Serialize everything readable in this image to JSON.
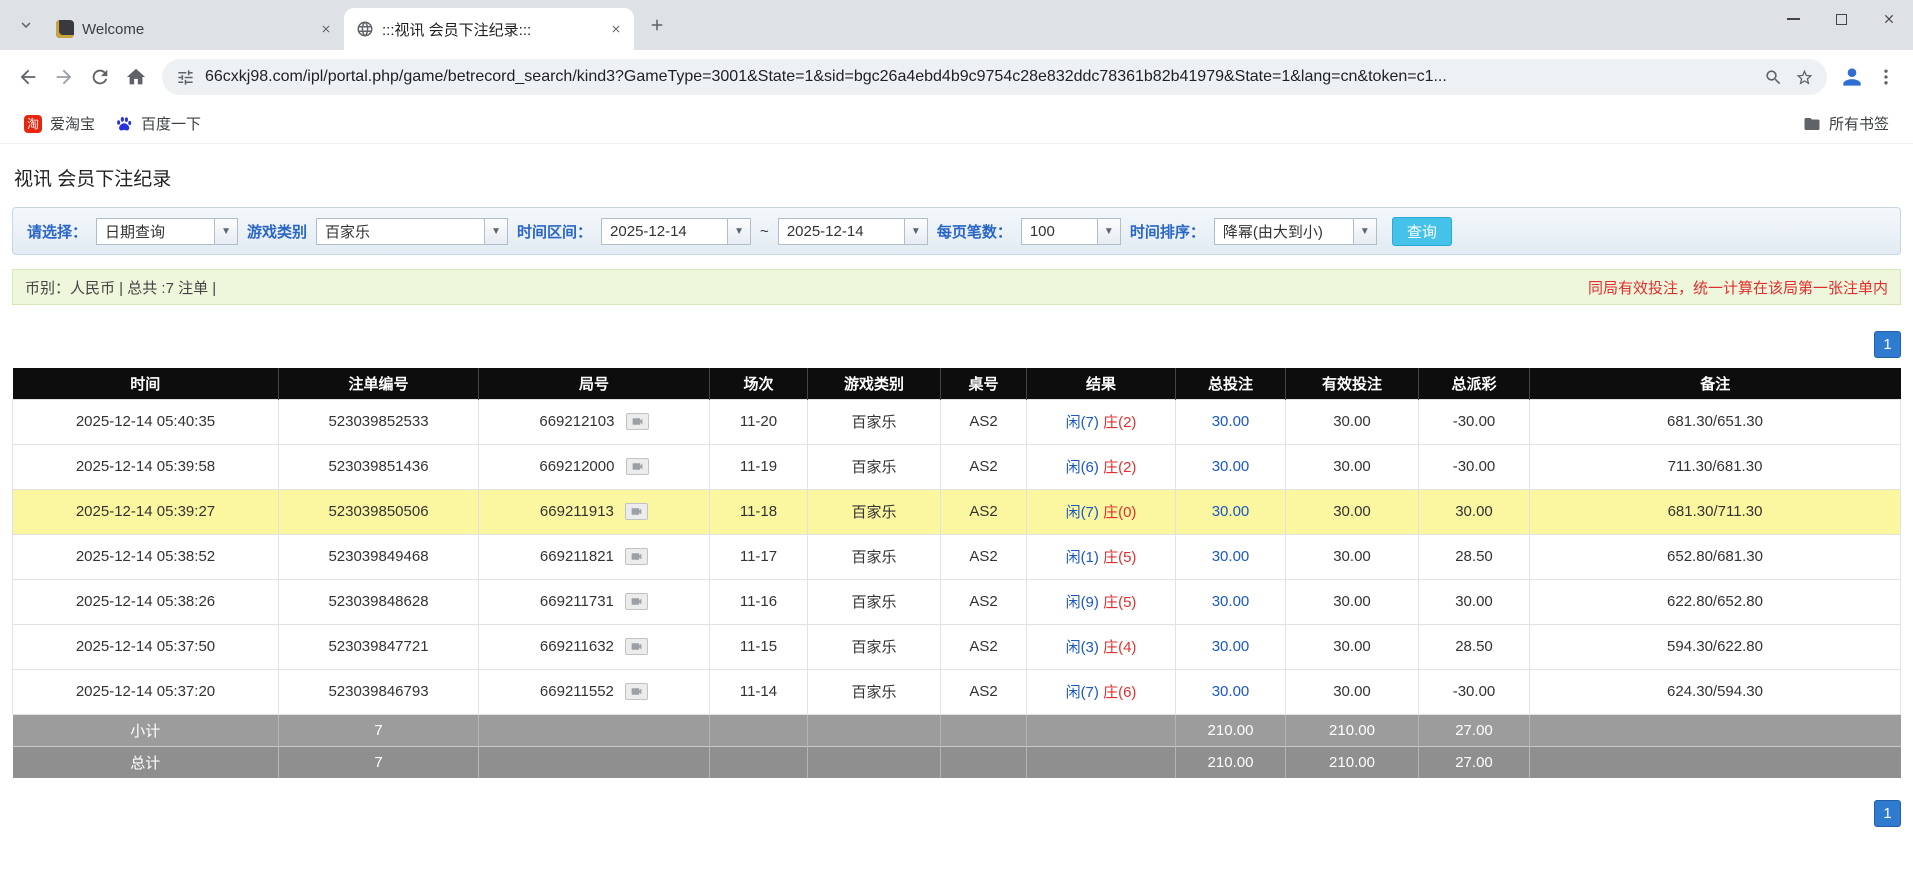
{
  "colors": {
    "accent_blue": "#2e7bd0",
    "link_blue": "#1a58c2",
    "loss_red": "#e02f2f",
    "notice_red": "#e12e2e",
    "highlight_yellow": "#fbf7a0",
    "header_black": "#0d0d0d",
    "footer_gray": "#9c9c9c",
    "footer_gray_dark": "#8f8f8f",
    "search_button_blue": "#45c2ea",
    "info_bar_green": "#eef6dc",
    "label_blue": "#2a66c8",
    "result_player_blue": "#1a58c2",
    "result_banker_red": "#e02f2f"
  },
  "browser": {
    "tabs": [
      {
        "title": "Welcome"
      },
      {
        "title": ":::视讯 会员下注纪录:::"
      }
    ],
    "url": "66cxkj98.com/ipl/portal.php/game/betrecord_search/kind3?GameType=3001&State=1&sid=bgc26a4ebd4b9c9754c28e832ddc78361b82b41979&State=1&lang=cn&token=c1...",
    "bookmarks": [
      {
        "label": "爱淘宝"
      },
      {
        "label": "百度一下"
      }
    ],
    "all_bookmarks_label": "所有书签"
  },
  "page": {
    "title": "视讯 会员下注纪录",
    "filters": {
      "select_label": "请选择：",
      "select_value": "日期查询",
      "game_type_label": "游戏类别",
      "game_type_value": "百家乐",
      "date_range_label": "时间区间：",
      "date_from": "2025-12-14",
      "tilde": "~",
      "date_to": "2025-12-14",
      "page_size_label": "每页笔数：",
      "page_size_value": "100",
      "sort_label": "时间排序：",
      "sort_value": "降幂(由大到小)",
      "search_button": "查询"
    },
    "info_bar": {
      "left": "币别：人民币 | 总共 :7 注单 |",
      "right": "同局有效投注，统一计算在该局第一张注单内"
    },
    "pagination": "1",
    "table": {
      "headers": [
        "时间",
        "注单编号",
        "局号",
        "场次",
        "游戏类别",
        "桌号",
        "结果",
        "总投注",
        "有效投注",
        "总派彩",
        "备注"
      ],
      "rows": [
        {
          "time": "2025-12-14 05:40:35",
          "bet_id": "523039852533",
          "round_id": "669212103",
          "session": "11-20",
          "game": "百家乐",
          "table_no": "AS2",
          "result_player": "闲(7)",
          "result_banker": "庄(2)",
          "total_bet": "30.00",
          "valid_bet": "30.00",
          "payout": "-30.00",
          "note": "681.30/651.30",
          "highlight": false
        },
        {
          "time": "2025-12-14 05:39:58",
          "bet_id": "523039851436",
          "round_id": "669212000",
          "session": "11-19",
          "game": "百家乐",
          "table_no": "AS2",
          "result_player": "闲(6)",
          "result_banker": "庄(2)",
          "total_bet": "30.00",
          "valid_bet": "30.00",
          "payout": "-30.00",
          "note": "711.30/681.30",
          "highlight": false
        },
        {
          "time": "2025-12-14 05:39:27",
          "bet_id": "523039850506",
          "round_id": "669211913",
          "session": "11-18",
          "game": "百家乐",
          "table_no": "AS2",
          "result_player": "闲(7)",
          "result_banker": "庄(0)",
          "total_bet": "30.00",
          "valid_bet": "30.00",
          "payout": "30.00",
          "note": "681.30/711.30",
          "highlight": true
        },
        {
          "time": "2025-12-14 05:38:52",
          "bet_id": "523039849468",
          "round_id": "669211821",
          "session": "11-17",
          "game": "百家乐",
          "table_no": "AS2",
          "result_player": "闲(1)",
          "result_banker": "庄(5)",
          "total_bet": "30.00",
          "valid_bet": "30.00",
          "payout": "28.50",
          "note": "652.80/681.30",
          "highlight": false
        },
        {
          "time": "2025-12-14 05:38:26",
          "bet_id": "523039848628",
          "round_id": "669211731",
          "session": "11-16",
          "game": "百家乐",
          "table_no": "AS2",
          "result_player": "闲(9)",
          "result_banker": "庄(5)",
          "total_bet": "30.00",
          "valid_bet": "30.00",
          "payout": "30.00",
          "note": "622.80/652.80",
          "highlight": false
        },
        {
          "time": "2025-12-14 05:37:50",
          "bet_id": "523039847721",
          "round_id": "669211632",
          "session": "11-15",
          "game": "百家乐",
          "table_no": "AS2",
          "result_player": "闲(3)",
          "result_banker": "庄(4)",
          "total_bet": "30.00",
          "valid_bet": "30.00",
          "payout": "28.50",
          "note": "594.30/622.80",
          "highlight": false
        },
        {
          "time": "2025-12-14 05:37:20",
          "bet_id": "523039846793",
          "round_id": "669211552",
          "session": "11-14",
          "game": "百家乐",
          "table_no": "AS2",
          "result_player": "闲(7)",
          "result_banker": "庄(6)",
          "total_bet": "30.00",
          "valid_bet": "30.00",
          "payout": "-30.00",
          "note": "624.30/594.30",
          "highlight": false
        }
      ],
      "subtotal": {
        "label": "小计",
        "count": "7",
        "total_bet": "210.00",
        "valid_bet": "210.00",
        "payout": "27.00"
      },
      "total": {
        "label": "总计",
        "count": "7",
        "total_bet": "210.00",
        "valid_bet": "210.00",
        "payout": "27.00"
      }
    }
  }
}
